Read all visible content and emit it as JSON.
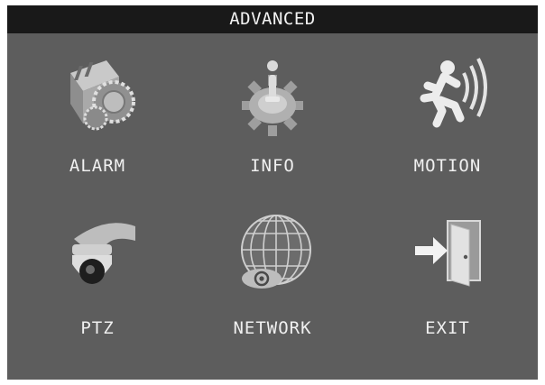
{
  "window": {
    "title": "ADVANCED"
  },
  "menu": {
    "items": [
      {
        "label": "ALARM",
        "icon": "alarm-bell-icon"
      },
      {
        "label": "INFO",
        "icon": "info-gear-icon"
      },
      {
        "label": "MOTION",
        "icon": "motion-runner-icon"
      },
      {
        "label": "PTZ",
        "icon": "ptz-camera-icon"
      },
      {
        "label": "NETWORK",
        "icon": "network-globe-icon"
      },
      {
        "label": "EXIT",
        "icon": "exit-door-icon"
      }
    ]
  },
  "colors": {
    "background": "#5d5d5d",
    "titlebar": "#191919",
    "text": "#f0f0f0"
  }
}
